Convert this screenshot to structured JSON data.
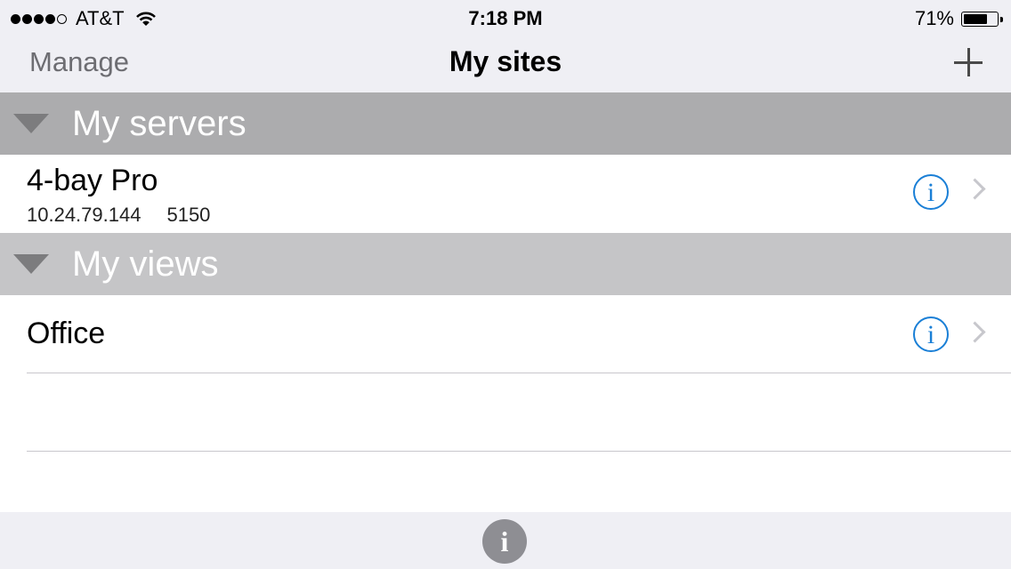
{
  "status_bar": {
    "carrier": "AT&T",
    "time": "7:18 PM",
    "battery_percent": "71%",
    "battery_level": 0.71,
    "signal_bars": 4,
    "signal_max": 5
  },
  "nav": {
    "left_label": "Manage",
    "title": "My sites",
    "add_icon": "plus-icon"
  },
  "sections": [
    {
      "header": "My servers",
      "items": [
        {
          "title": "4-bay Pro",
          "address": "10.24.79.144",
          "port": "5150",
          "info_glyph": "i"
        }
      ]
    },
    {
      "header": "My views",
      "items": [
        {
          "title": "Office",
          "info_glyph": "i"
        }
      ]
    }
  ],
  "toolbar": {
    "info_glyph": "i"
  },
  "colors": {
    "accent": "#1a7fd6",
    "section_header_1": "#acacae",
    "section_header_2": "#c5c5c7",
    "bar_background": "#efeff4"
  }
}
